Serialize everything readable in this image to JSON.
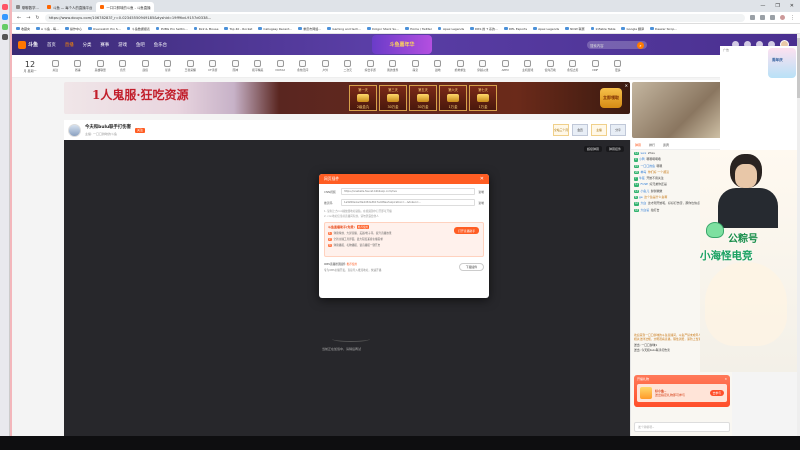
{
  "browser": {
    "tabs": [
      {
        "label": "聊聊数学…"
      },
      {
        "label": "斗鱼 — 每个人的直播平台"
      },
      {
        "label": "一口口鲜味的斗鱼 - 斗鱼直播",
        "active": true
      }
    ],
    "url": "https://www.douyu.com/10678283?_r=0.02345550949185&dyshid=19ff9bd-9157d0338...",
    "bookmarks": [
      "收藏夹",
      "A 斗鱼 - 每…",
      "操作中心",
      "Overwatch Pro S…",
      "斗鱼数据报表",
      "PUBG Pro Settin…",
      "Rx2 & Mouse",
      "Top 40 - Rocket",
      "Callugasy Recent…",
      "重庆市网络…",
      "Gaming and tech…",
      "Dolgor Stack Su…",
      "Home / Twitter",
      "Apex Legends",
      "DRS 的 T 系的…",
      "DEL Esports",
      "Apex Legends",
      "NOW 联赛",
      "Inflable Table",
      "Google 翻译",
      "Deezer Sirop…"
    ],
    "window_controls": [
      "—",
      "❐",
      "✕"
    ]
  },
  "nav": {
    "logo": "斗鱼",
    "items": [
      "首页",
      "直播",
      "分类",
      "赛事",
      "游戏",
      "鱼吧",
      "鱼乐台"
    ],
    "active": "直播",
    "promo": "斗鱼嘉年华",
    "search_placeholder": "搜索内容",
    "search_icon": "search-icon"
  },
  "categories": {
    "date_num": "12",
    "date_label": "月 星期一",
    "items": [
      "关注",
      "赛事",
      "英雄联盟",
      "音乐",
      "颜值",
      "星秀",
      "王者荣耀",
      "CF手游",
      "原神",
      "和平精英",
      "DOTA2",
      "永劫无间",
      "户外",
      "二次元",
      "综合手游",
      "我的世界",
      "萌宠",
      "战地",
      "绝地求生",
      "穿越火线",
      "APEX",
      "主机游戏",
      "使命召唤",
      "永恒之塔",
      "DNF",
      "更多"
    ],
    "pc_button": "PC端下载"
  },
  "banner": {
    "slogan": "1人鬼服·狂吃资源",
    "cards": [
      {
        "title": "第一天",
        "reward": "2级盒丸"
      },
      {
        "title": "第三天",
        "reward": "30万金"
      },
      {
        "title": "第五天",
        "reward": "30万金"
      },
      {
        "title": "第六天",
        "reward": "1万金"
      },
      {
        "title": "第七天",
        "reward": "1万金"
      }
    ],
    "cta": "立即领取",
    "close": "✕"
  },
  "streamer": {
    "title": "今夫和bulu联手打伤害",
    "sub": "主播: 一口口鲜味的斗鱼",
    "follow": "关注",
    "tags": [
      "全站三个月",
      "会员",
      "主播",
      "分享"
    ]
  },
  "player": {
    "buttons": [
      "超级弹幕",
      "弹幕挂件"
    ],
    "hint": "当前正在加载中，请稍后再试"
  },
  "modal": {
    "title": "网页插件",
    "close": "✕",
    "rows": [
      {
        "label": "CNN视频",
        "value": "https://anabells-faucet.bilbilaxp.com/live",
        "copy": "复制"
      },
      {
        "label": "推流码",
        "value": "1a9266e1ac8a4d3da3617ad28ea?expiration=…&token=…",
        "copy": "复制"
      }
    ],
    "notes": [
      "1. 复制上方cnn播放器地址粘贴，在视频源中打开即可开播",
      "2. cnn地址仅当前直播间有效，请勿泄露给他人"
    ],
    "promo_title": "斗鱼直播助手(免费)",
    "promo_label": "推荐使用",
    "promo_button": "打开直播助手",
    "promo_lines": [
      {
        "tag": "1",
        "text": "弹幕特效、大屏直播、美颜/粒子等，提升直播效果"
      },
      {
        "tag": "2",
        "text": "全新主播工具界面，最大程度兼容主播需求"
      },
      {
        "tag": "3",
        "text": "弹幕播报、礼物播报、语音播报一键开启"
      }
    ],
    "plug_title": "OBS直播推流插件",
    "plug_tag": "推荐使用",
    "plug_desc": "专为OBS主播开发，直接导入推流地址，快速开播",
    "plug_button": "下载插件"
  },
  "chat": {
    "tabs": [
      "弹幕",
      "排行",
      "贵宾"
    ],
    "messages": [
      {
        "badge": "12",
        "user": "wxx",
        "text": "Zhxu"
      },
      {
        "badge": "9",
        "user": "小鸭",
        "text": "嗯嗯啊啊哦"
      },
      {
        "badge": "15",
        "user": "一口口的鱼",
        "text": "嗯嗯"
      },
      {
        "badge": "20",
        "user": "神马",
        "text": "你们好 一个都没"
      },
      {
        "badge": "7",
        "user": "牛猛",
        "text": "开始不用关注"
      },
      {
        "badge": "11",
        "user": "FUSE",
        "text": "好兄弟你还是"
      },
      {
        "badge": "13",
        "user": "小鱼儿",
        "text": "鲜鲜嫩嫩"
      },
      {
        "badge": "8",
        "user": "ge",
        "text": "这个鱼是什么鱼啊"
      },
      {
        "badge": "16",
        "user": "大白",
        "text": "这才刚开始呢，好好打伤害，那你也快点努力啊"
      },
      {
        "badge": "18",
        "user": "大白鲨",
        "text": "拍打击"
      }
    ],
    "notice": "欢迎来到一口口鲜味的斗鱼直播间，斗鱼严禁未成年人直播和打赏，请遵守相关法律法规，文明观看直播，理性消费，谨防上当受骗。",
    "extra": [
      "送出: 一口口鲜味1",
      "送出: 今天和bulu联手打伤害"
    ],
    "gift_header": "开播礼物",
    "gift_close": "✕",
    "gift_name": "好小鱼~",
    "gift_desc": "送出指定礼物即可参与",
    "gift_button": "去参与",
    "input_placeholder": "发个弹幕呗~"
  },
  "cam": {
    "text1": "公粽号",
    "text2": "小海怪电竞"
  },
  "side": {
    "ad_label": "广告",
    "deco_title": "周年庆"
  }
}
